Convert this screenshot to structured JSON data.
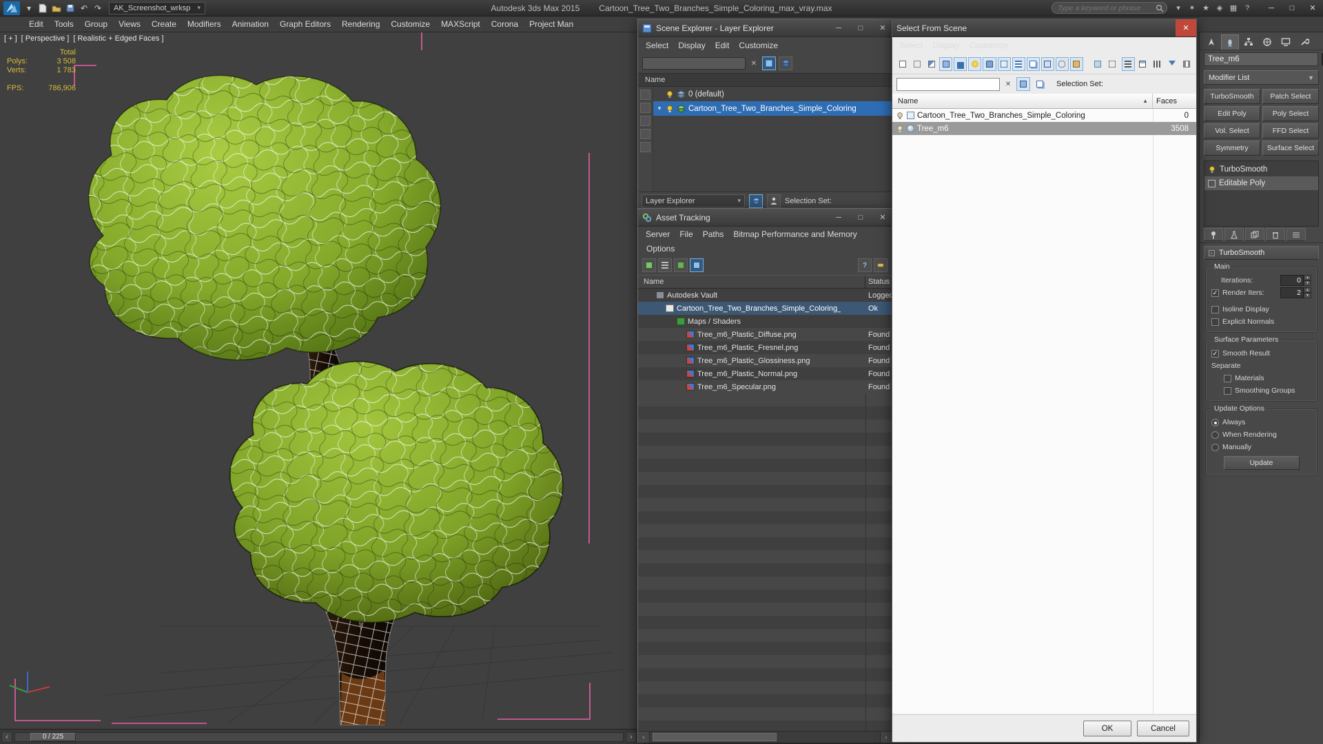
{
  "icons": {
    "dropdown": "▾",
    "minimize": "─",
    "maximize": "□",
    "close": "✕",
    "clear": "✕",
    "collapsed": "▸",
    "expanded": "▾",
    "scroll_left": "‹",
    "scroll_right": "›",
    "sort_asc": "▲",
    "spin_up": "▲",
    "spin_down": "▼",
    "check": "✓",
    "undo": "↶",
    "redo": "↷",
    "sparkle": "✶",
    "star": "★",
    "diamond": "◈",
    "grid": "▦",
    "help": "?"
  },
  "titlebar": {
    "workspace": "AK_Screenshot_wrksp",
    "app_title": "Autodesk 3ds Max  2015",
    "doc_title": "Cartoon_Tree_Two_Branches_Simple_Coloring_max_vray.max",
    "search_placeholder": "Type a keyword or phrase"
  },
  "menubar": {
    "items": [
      "Edit",
      "Tools",
      "Group",
      "Views",
      "Create",
      "Modifiers",
      "Animation",
      "Graph Editors",
      "Rendering",
      "Customize",
      "MAXScript",
      "Corona",
      "Project Man"
    ]
  },
  "viewport": {
    "label_plus": "[ + ]",
    "label_view": "[ Perspective ]",
    "label_shading": "[ Realistic + Edged Faces ]",
    "stats": {
      "total": "Total",
      "polys_label": "Polys:",
      "polys": "3 508",
      "verts_label": "Verts:",
      "verts": "1 783",
      "fps_label": "FPS:",
      "fps": "786,906"
    },
    "timeline": "0 / 225"
  },
  "scene_explorer": {
    "title": "Scene Explorer - Layer Explorer",
    "menus": [
      "Select",
      "Display",
      "Edit",
      "Customize"
    ],
    "header_name": "Name",
    "rows": [
      {
        "label": "0 (default)"
      },
      {
        "label": "Cartoon_Tree_Two_Branches_Simple_Coloring"
      }
    ],
    "footer_mode": "Layer Explorer",
    "footer_selection_set": "Selection Set:"
  },
  "asset_tracking": {
    "title": "Asset Tracking",
    "menus": [
      "Server",
      "File",
      "Paths",
      "Bitmap Performance and Memory",
      "Options"
    ],
    "col_name": "Name",
    "col_status": "Status",
    "rows": [
      {
        "name": "Autodesk Vault",
        "status": "Logged"
      },
      {
        "name": "Cartoon_Tree_Two_Branches_Simple_Coloring_...",
        "status": "Ok"
      },
      {
        "name": "Maps / Shaders",
        "status": ""
      },
      {
        "name": "Tree_m6_Plastic_Diffuse.png",
        "status": "Found"
      },
      {
        "name": "Tree_m6_Plastic_Fresnel.png",
        "status": "Found"
      },
      {
        "name": "Tree_m6_Plastic_Glossiness.png",
        "status": "Found"
      },
      {
        "name": "Tree_m6_Plastic_Normal.png",
        "status": "Found"
      },
      {
        "name": "Tree_m6_Specular.png",
        "status": "Found"
      }
    ]
  },
  "select_from_scene": {
    "title": "Select From Scene",
    "menus": [
      "Select",
      "Display",
      "Customize"
    ],
    "selection_set_label": "Selection Set:",
    "col_name": "Name",
    "col_faces": "Faces",
    "rows": [
      {
        "name": "Cartoon_Tree_Two_Branches_Simple_Coloring",
        "faces": "0"
      },
      {
        "name": "Tree_m6",
        "faces": "3508"
      }
    ],
    "ok": "OK",
    "cancel": "Cancel"
  },
  "command_panel": {
    "object_name": "Tree_m6",
    "modifier_list": "Modifier List",
    "modifier_buttons": [
      "TurboSmooth",
      "Patch Select",
      "Edit Poly",
      "Poly Select",
      "Vol. Select",
      "FFD Select",
      "Symmetry",
      "Surface Select"
    ],
    "stack": [
      "TurboSmooth",
      "Editable Poly"
    ],
    "rollout": {
      "title": "TurboSmooth",
      "main": "Main",
      "iterations_label": "Iterations:",
      "iterations_value": "0",
      "render_iters_label": "Render Iters:",
      "render_iters_value": "2",
      "isoline": "Isoline Display",
      "explicit_normals": "Explicit Normals",
      "surface_parameters": "Surface Parameters",
      "smooth_result": "Smooth Result",
      "separate": "Separate",
      "materials": "Materials",
      "smoothing_groups": "Smoothing Groups",
      "update_options": "Update Options",
      "always": "Always",
      "when_rendering": "When Rendering",
      "manually": "Manually",
      "update": "Update"
    }
  }
}
